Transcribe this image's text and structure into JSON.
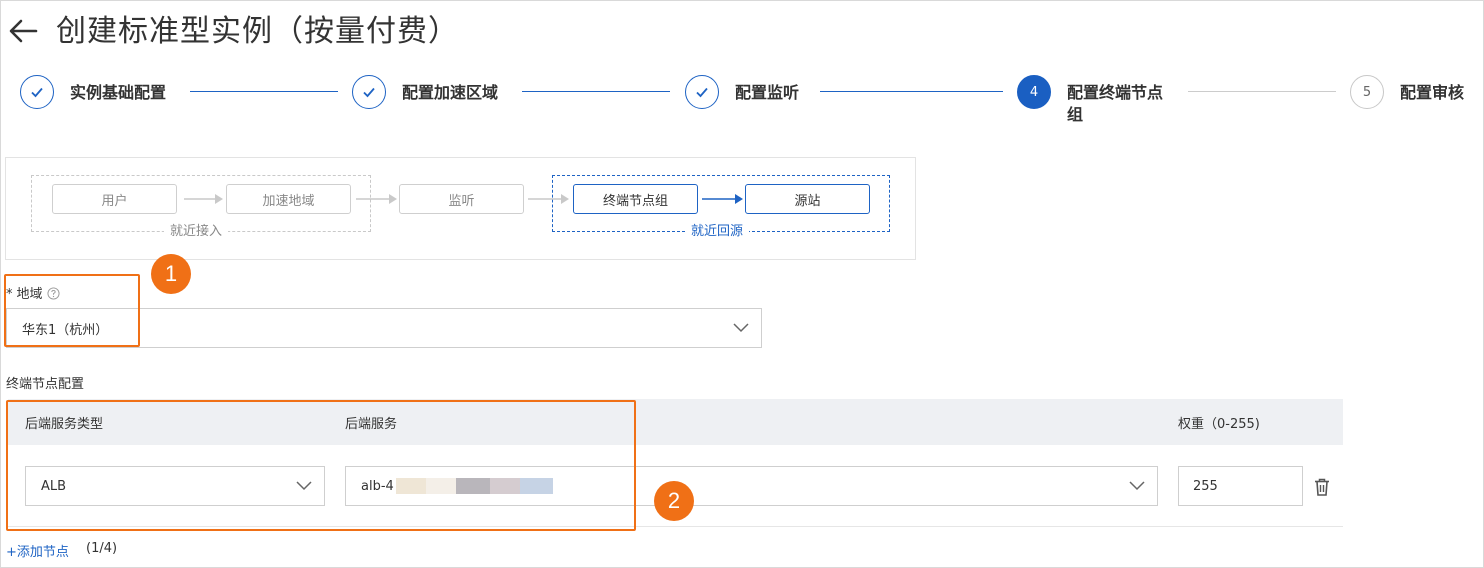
{
  "header": {
    "title": "创建标准型实例（按量付费）"
  },
  "stepper": {
    "steps": [
      {
        "label": "实例基础配置",
        "state": "done"
      },
      {
        "label": "配置加速区域",
        "state": "done"
      },
      {
        "label": "配置监听",
        "state": "done"
      },
      {
        "number": "4",
        "label_line1": "配置终端节点",
        "label_line2": "组",
        "state": "active"
      },
      {
        "number": "5",
        "label": "配置审核",
        "state": "todo"
      }
    ]
  },
  "diagram": {
    "nodes": {
      "user": "用户",
      "accel_region": "加速地域",
      "listener": "监听",
      "endpoint_group": "终端节点组",
      "origin": "源站"
    },
    "group_labels": {
      "nearby_access": "就近接入",
      "nearby_origin": "就近回源"
    }
  },
  "region": {
    "required_mark": "*",
    "label": "地域",
    "value": "华东1（杭州）"
  },
  "endpoint_config": {
    "section_label": "终端节点配置",
    "columns": {
      "backend_type": "后端服务类型",
      "backend_service": "后端服务",
      "weight": "权重（0-255)"
    },
    "row": {
      "backend_type": "ALB",
      "backend_service_prefix": "alb-4",
      "weight": "255"
    },
    "add_link": "+添加节点",
    "count": "(1/4)"
  },
  "annotations": {
    "one": "1",
    "two": "2"
  },
  "colors": {
    "primary": "#1e63c4",
    "annotation": "#f07016",
    "table_header_bg": "#eef0f3"
  }
}
